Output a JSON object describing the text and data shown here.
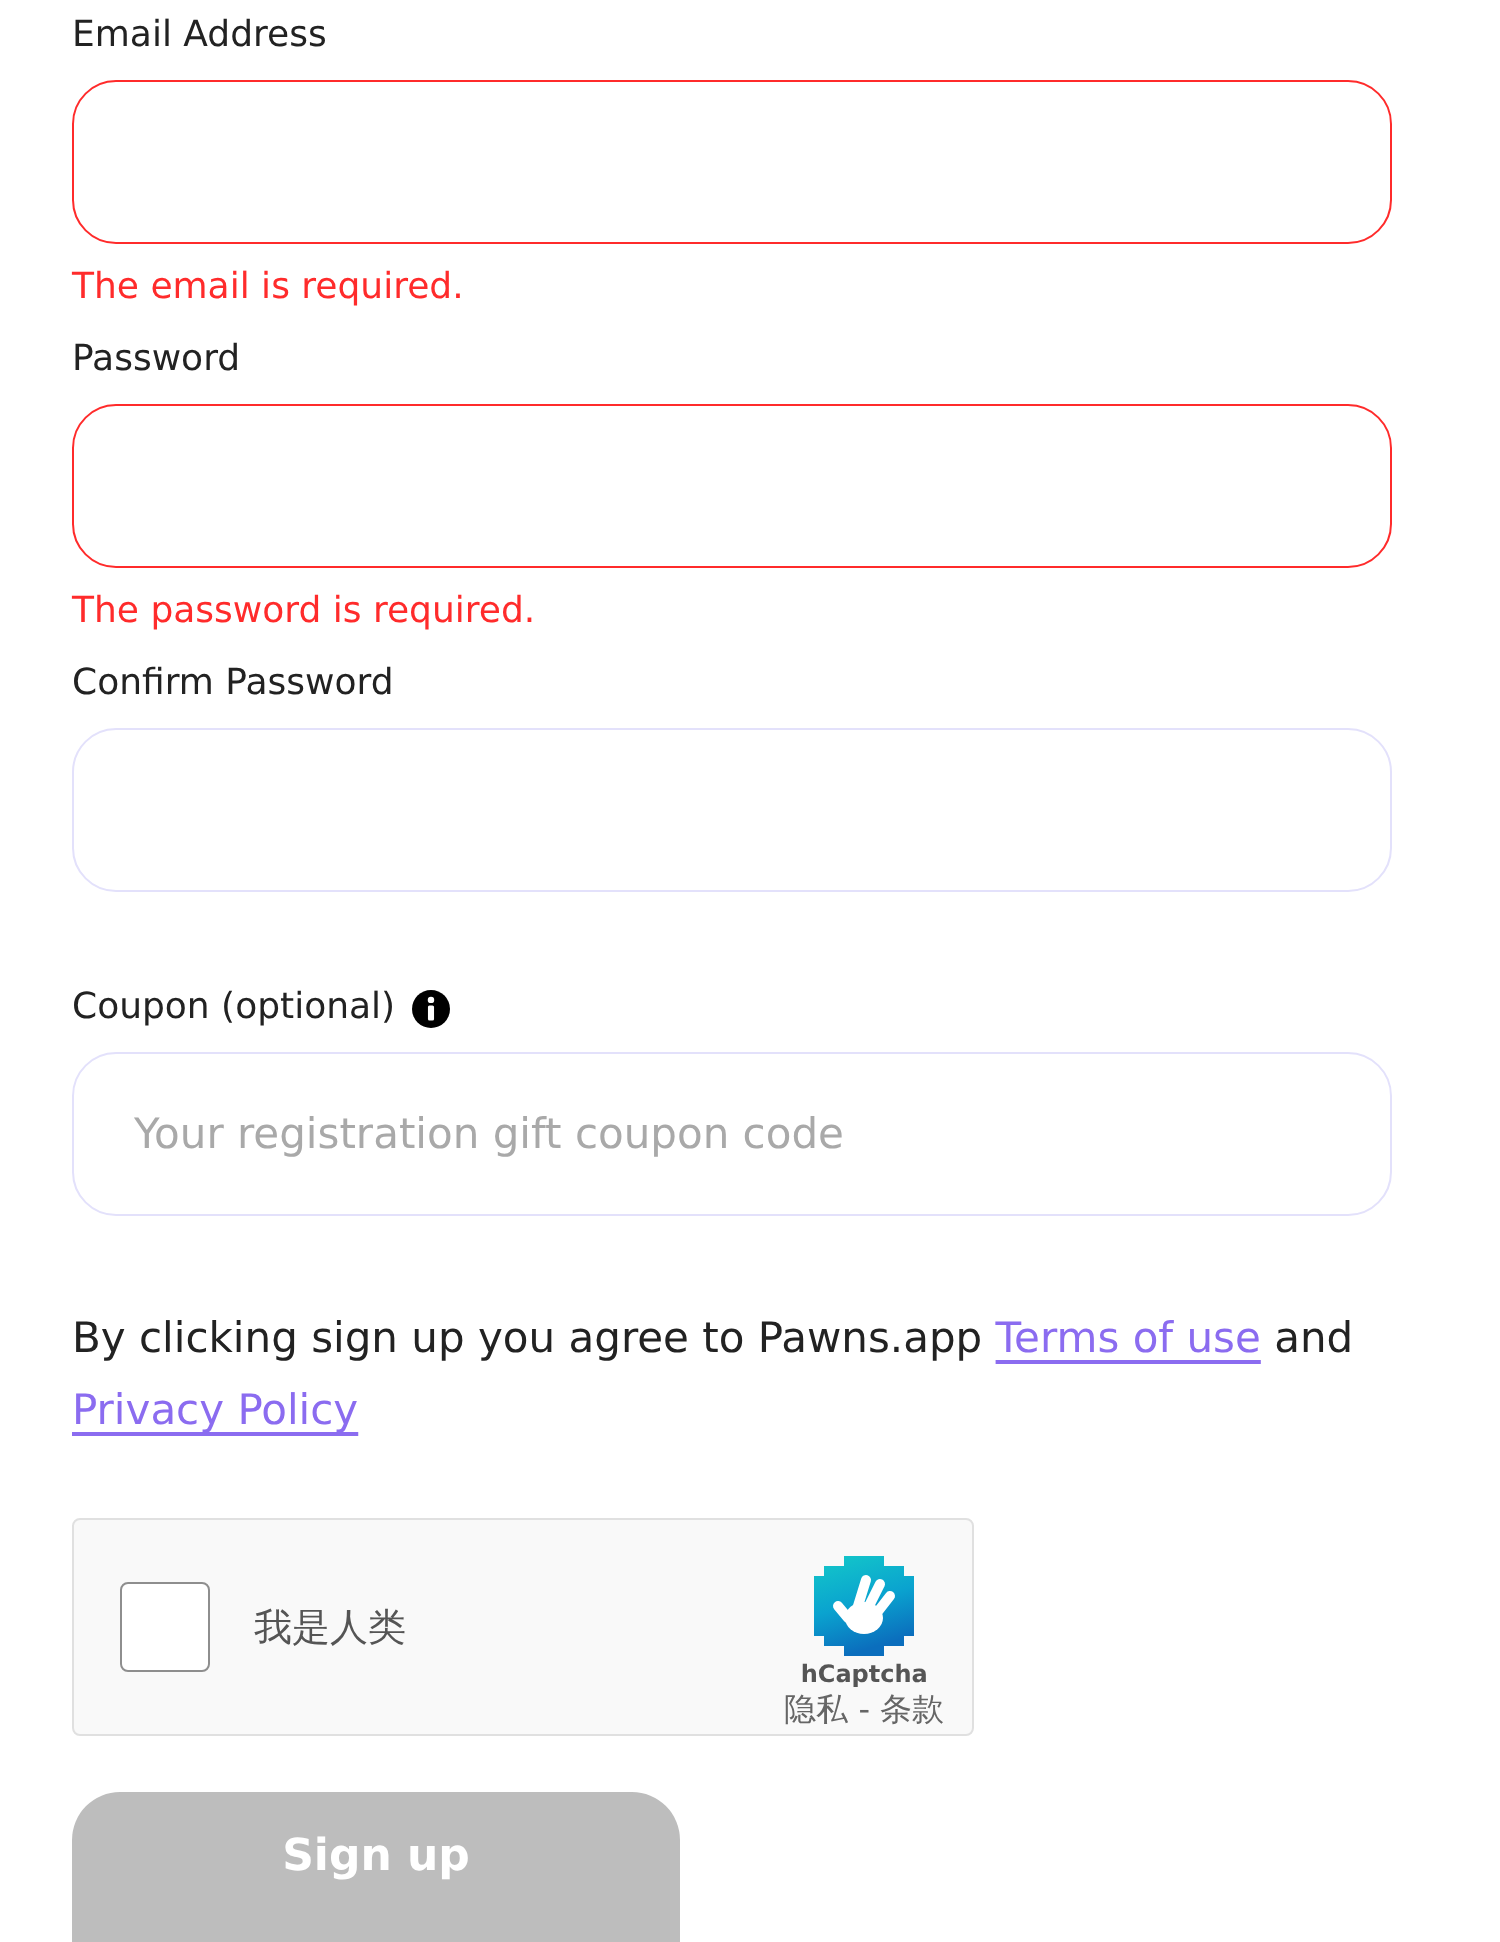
{
  "fields": [
    {
      "label": "Email Address",
      "invalid": true,
      "error": "The email is required."
    },
    {
      "label": "Password",
      "invalid": true,
      "error": "The password is required."
    },
    {
      "label": "Confirm Password",
      "invalid": false
    },
    {
      "label": "Coupon (optional)",
      "invalid": false,
      "info_icon": true,
      "placeholder": "Your registration gift coupon code"
    }
  ],
  "consent": {
    "before": "By clicking sign up you agree to Pawns.app",
    "terms_link": "Terms of use",
    "middle": "and",
    "privacy_link": "Privacy Policy"
  },
  "captcha": {
    "checked": false,
    "label": "我是人类",
    "brand": "hCaptcha",
    "links": [
      "隐私",
      "条款"
    ],
    "separator": "-"
  },
  "submit": {
    "label": "Sign up",
    "disabled": true
  }
}
